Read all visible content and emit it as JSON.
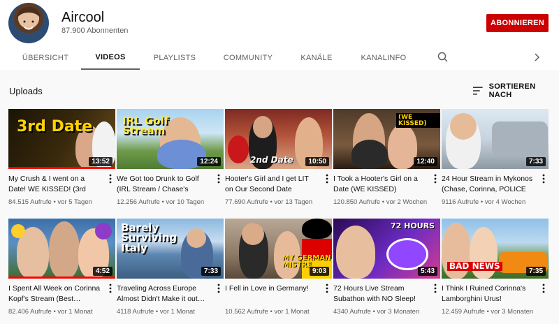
{
  "channel": {
    "name": "Aircool",
    "subscribers": "87.900 Abonnenten",
    "subscribe_label": "ABONNIEREN"
  },
  "tabs": [
    "ÜBERSICHT",
    "VIDEOS",
    "PLAYLISTS",
    "COMMUNITY",
    "KANÄLE",
    "KANALINFO"
  ],
  "active_tab": "VIDEOS",
  "section": {
    "title": "Uploads",
    "sort_label": "SORTIEREN NACH"
  },
  "videos": [
    {
      "title": "My Crush & I went on a Date! WE KISSED! (3rd Date)",
      "views": "84.515 Aufrufe",
      "age": "vor 5 Tagen",
      "duration": "13:52",
      "overlay": "3rd Date",
      "watched": 1.0
    },
    {
      "title": "We Got too Drunk to Golf (IRL Stream / Chase's Birthday)",
      "views": "12.256 Aufrufe",
      "age": "vor 10 Tagen",
      "duration": "12:24",
      "overlay": "IRL Golf Stream",
      "watched": 0
    },
    {
      "title": "Hooter's Girl and I get LIT on Our Second Date",
      "views": "77.690 Aufrufe",
      "age": "vor 13 Tagen",
      "duration": "10:50",
      "overlay": "2nd Date",
      "watched": 0
    },
    {
      "title": "I Took a Hooter's Girl on a Date (WE KISSED)",
      "views": "120.850 Aufrufe",
      "age": "vor 2 Wochen",
      "duration": "12:40",
      "overlay": "(WE KISSED)",
      "watched": 0
    },
    {
      "title": "24 Hour Stream in Mykonos (Chase, Corinna, POLICE &…",
      "views": "9116 Aufrufe",
      "age": "vor 4 Wochen",
      "duration": "7:33",
      "overlay": "",
      "watched": 0
    },
    {
      "title": "I Spent All Week on Corinna Kopf's Stream (Best…",
      "views": "82.406 Aufrufe",
      "age": "vor 1 Monat",
      "duration": "4:52",
      "overlay": "",
      "watched": 1.0
    },
    {
      "title": "Traveling Across Europe Almost Didn't Make it out…",
      "views": "4118 Aufrufe",
      "age": "vor 1 Monat",
      "duration": "7:33",
      "overlay": "Barely Surviving Italy",
      "watched": 0
    },
    {
      "title": "I Fell in Love in Germany!",
      "views": "10.562 Aufrufe",
      "age": "vor 1 Monat",
      "duration": "9:03",
      "overlay": "MY GERMAN MISTRE",
      "watched": 0
    },
    {
      "title": "72 Hours Live Stream Subathon with NO Sleep!",
      "views": "4340 Aufrufe",
      "age": "vor 3 Monaten",
      "duration": "5:43",
      "overlay": "72 HOURS",
      "watched": 0
    },
    {
      "title": "I Think I Ruined Corinna's Lamborghini Urus!",
      "views": "12.459 Aufrufe",
      "age": "vor 3 Monaten",
      "duration": "7:35",
      "overlay": "BAD NEWS",
      "watched": 0
    }
  ],
  "colors": {
    "subscribe": "#cc0000",
    "progress": "#ff0000",
    "muted_text": "#606060"
  }
}
